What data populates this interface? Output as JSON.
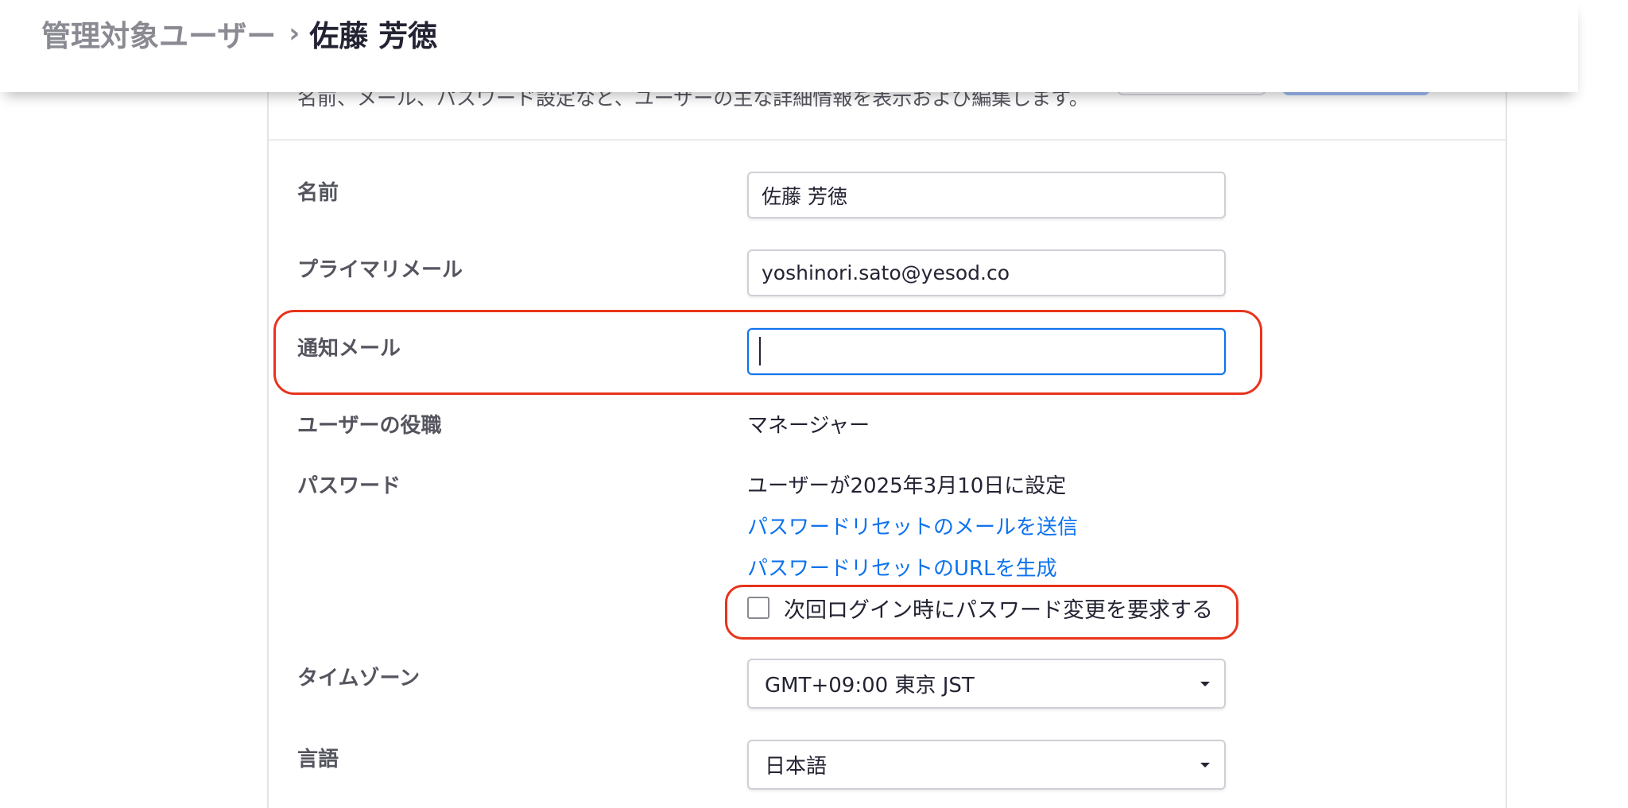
{
  "breadcrumb": {
    "parent": "管理対象ユーザー",
    "separator": "›",
    "current": "佐藤 芳徳"
  },
  "section": {
    "description": "名前、メール、パスワード設定など、ユーザーの主な詳細情報を表示および編集します。"
  },
  "form": {
    "name": {
      "label": "名前",
      "value": "佐藤 芳徳"
    },
    "primary_email": {
      "label": "プライマリメール",
      "value": "yoshinori.sato@yesod.co"
    },
    "notification_email": {
      "label": "通知メール",
      "value": ""
    },
    "role": {
      "label": "ユーザーの役職",
      "value": "マネージャー"
    },
    "password": {
      "label": "パスワード",
      "status": "ユーザーが2025年3月10日に設定",
      "send_reset_email_link": "パスワードリセットのメールを送信",
      "generate_reset_url_link": "パスワードリセットのURLを生成",
      "require_change_checkbox": {
        "label": "次回ログイン時にパスワード変更を要求する",
        "checked": false
      }
    },
    "timezone": {
      "label": "タイムゾーン",
      "selected": "GMT+09:00 東京 JST"
    },
    "language": {
      "label": "言語",
      "selected": "日本語"
    }
  },
  "colors": {
    "link": "#0e72ed",
    "focus_border": "#0e72ed",
    "annotation": "#e8341c"
  }
}
